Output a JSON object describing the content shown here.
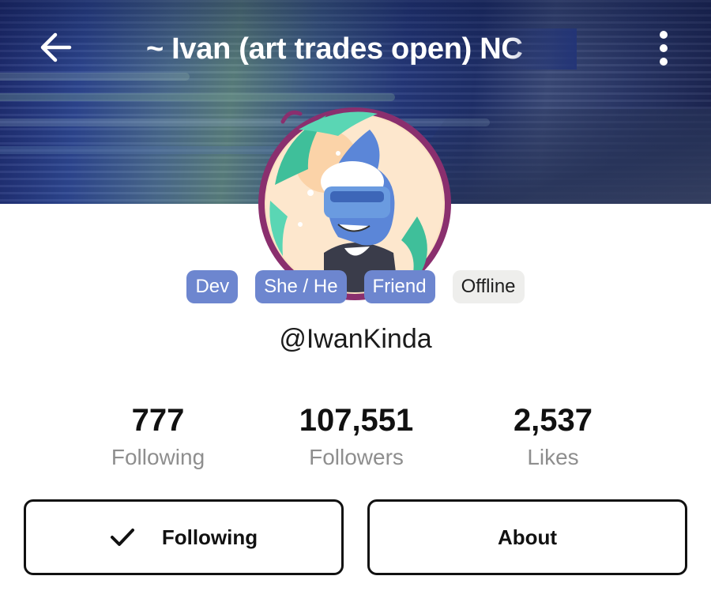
{
  "header": {
    "title": "~ Ivan (art trades open) NC",
    "back_icon": "arrow-left-icon",
    "menu_icon": "more-vertical-icon"
  },
  "profile": {
    "avatar_icon": "avatar-illustration",
    "handle": "@IwanKinda",
    "tags": [
      {
        "label": "Dev",
        "color": "#6d86cf"
      },
      {
        "label": "She / He",
        "color": "#6d86cf"
      },
      {
        "label": "Friend",
        "color": "#6d86cf"
      },
      {
        "label": "Offline",
        "color": "#eeeeec"
      }
    ]
  },
  "stats": [
    {
      "value": "777",
      "label": "Following"
    },
    {
      "value": "107,551",
      "label": "Followers"
    },
    {
      "value": "2,537",
      "label": "Likes"
    }
  ],
  "actions": {
    "following_label": "Following",
    "following_icon": "checkmark-icon",
    "about_label": "About"
  },
  "colors": {
    "accent_tag": "#6d86cf",
    "offline_tag": "#eeeeec",
    "stat_label": "#8e8e8e",
    "text": "#111111"
  }
}
